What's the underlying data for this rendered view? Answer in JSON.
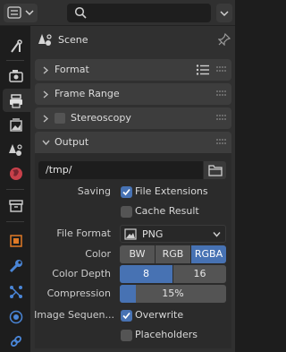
{
  "header": {
    "editor_type_icon": "properties-editor-icon",
    "search": {
      "placeholder": "",
      "value": ""
    }
  },
  "tabs": [
    {
      "name": "tool-tab",
      "icon": "wrench-screwdriver-icon"
    },
    {
      "name": "render-tab",
      "icon": "camera-back-icon"
    },
    {
      "name": "output-tab",
      "icon": "printer-icon",
      "active": true
    },
    {
      "name": "view-layer-tab",
      "icon": "image-stack-icon"
    },
    {
      "name": "scene-tab",
      "icon": "scene-cone-sphere-icon"
    },
    {
      "name": "world-tab",
      "icon": "globe-icon"
    },
    {
      "name": "collection-tab",
      "icon": "box-icon"
    },
    {
      "name": "object-tab",
      "icon": "orange-square-icon"
    },
    {
      "name": "modifier-tab",
      "icon": "wrench-icon"
    },
    {
      "name": "particles-tab",
      "icon": "particles-icon"
    },
    {
      "name": "physics-tab",
      "icon": "orbit-icon"
    },
    {
      "name": "constraints-tab",
      "icon": "link-icon"
    }
  ],
  "context": {
    "scene_label": "Scene"
  },
  "panels": {
    "format": "Format",
    "frame_range": "Frame Range",
    "stereoscopy": "Stereoscopy",
    "output": "Output"
  },
  "output": {
    "path": "/tmp/",
    "saving_label": "Saving",
    "file_extensions_label": "File Extensions",
    "file_extensions_checked": true,
    "cache_result_label": "Cache Result",
    "cache_result_checked": false,
    "file_format_label": "File Format",
    "file_format_value": "PNG",
    "color_label": "Color",
    "color_options": [
      "BW",
      "RGB",
      "RGBA"
    ],
    "color_selected": "RGBA",
    "color_depth_label": "Color Depth",
    "color_depth_options": [
      "8",
      "16"
    ],
    "color_depth_selected": "8",
    "compression_label": "Compression",
    "compression_value": "15%",
    "compression_fraction": 0.15,
    "image_sequence_label": "Image Sequen...",
    "overwrite_label": "Overwrite",
    "overwrite_checked": true,
    "placeholders_label": "Placeholders",
    "placeholders_checked": false
  },
  "colors": {
    "accent": "#4772b3",
    "panel_bg": "#303030",
    "sidebar_bg": "#1d1d1d"
  }
}
